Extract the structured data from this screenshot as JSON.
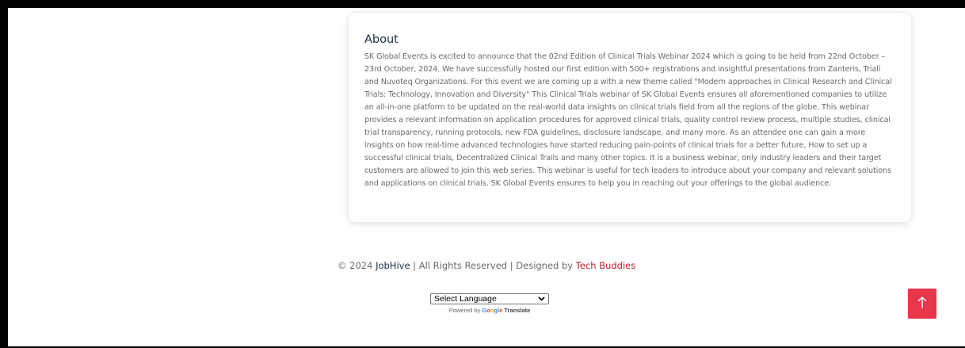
{
  "about": {
    "title": "About",
    "text": "SK Global Events is excited to announce that the 02nd Edition of Clinical Trials Webinar 2024 which is going to be held from 22nd October – 23rd October, 2024. We have successfully hosted our first edition with 500+ registrations and insightful presentations from Zanteris, Triall and Nuvoteq Organizations. For this event we are coming up a with a new theme called \"Modern approaches in Clinical Research and Clinical Trials: Technology, Innovation and Diversity\" This Clinical Trials webinar of SK Global Events ensures all aforementioned companies to utilize an all-in-one platform to be updated on the real-world data insights on clinical trials field from all the regions of the globe. This webinar provides a relevant information on application procedures for approved clinical trials, quality control review process, multiple studies, clinical trial transparency, running protocols, new FDA guidelines, disclosure landscape, and many more. As an attendee one can gain a more insights on how real-time advanced technologies have started reducing pain-points of clinical trials for a better future, How to set up a successful clinical trials, Decentralized Clinical Trails and many other topics. It is a business webinar, only industry leaders and their target customers are allowed to join this web series. This webinar is useful for tech leaders to introduce about your company and relevant solutions and applications on clinical trials. SK Global Events ensures to help you in reaching out your offerings to the global audience."
  },
  "footer": {
    "copyright_prefix": "© 2024 ",
    "brand": "JobHive",
    "rights": " | All Rights Reserved | Designed by ",
    "designer": "Tech Buddies"
  },
  "translate": {
    "select_label": "Select Language",
    "powered_by": "Powered by ",
    "google": [
      "G",
      "o",
      "o",
      "g",
      "l",
      "e"
    ],
    "translate_word": "Translate"
  },
  "back_to_top": {
    "icon": "arrow-up-icon",
    "color": "#e8364b"
  },
  "colors": {
    "heading": "#1d2b4d",
    "body_text": "#6b6b6b",
    "designer_link": "#c0202e"
  }
}
